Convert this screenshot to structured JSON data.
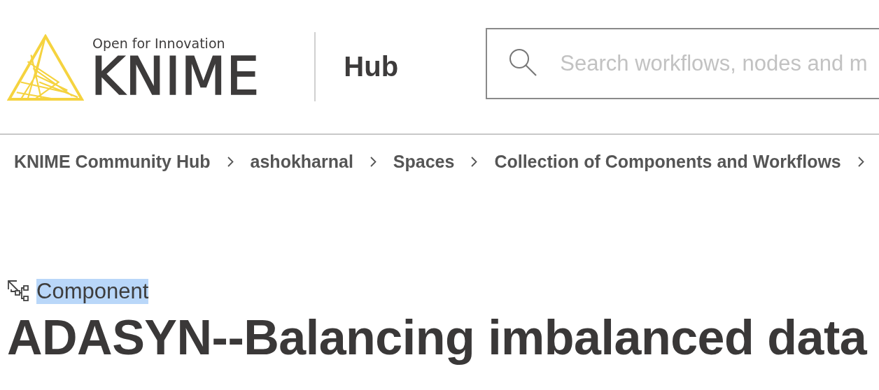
{
  "header": {
    "logo": {
      "tagline": "Open for Innovation",
      "wordmark": "KNIME"
    },
    "section": "Hub",
    "search": {
      "placeholder": "Search workflows, nodes and m"
    }
  },
  "breadcrumbs": [
    {
      "label": "KNIME Community Hub"
    },
    {
      "label": "ashokharnal"
    },
    {
      "label": "Spaces"
    },
    {
      "label": "Collection of Components and Workflows"
    }
  ],
  "item": {
    "type_label": "Component",
    "type_label_highlighted": true,
    "title": "ADASYN--Balancing imbalanced data"
  }
}
